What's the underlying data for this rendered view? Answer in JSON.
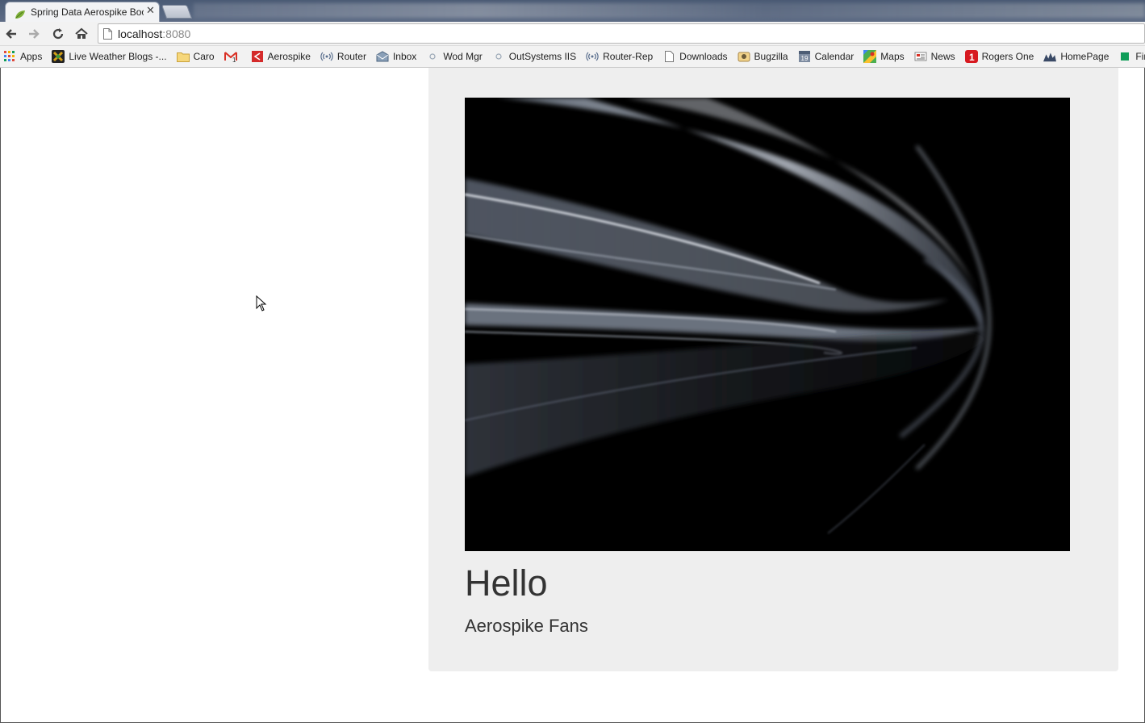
{
  "browser": {
    "active_tab": {
      "title": "Spring Data Aerospike Boo",
      "close_glyph": "✕"
    },
    "address_bar": {
      "host": "localhost",
      "port": ":8080"
    },
    "bookmarks": [
      {
        "label": "Apps",
        "icon": "apps-grid-icon"
      },
      {
        "label": "Live Weather Blogs -...",
        "icon": "weather-icon"
      },
      {
        "label": "Caro",
        "icon": "folder-icon"
      },
      {
        "label": "",
        "icon": "gmail-icon"
      },
      {
        "label": "Aerospike",
        "icon": "aerospike-icon"
      },
      {
        "label": "Router",
        "icon": "router-icon"
      },
      {
        "label": "Inbox",
        "icon": "inbox-icon"
      },
      {
        "label": "Wod Mgr",
        "icon": "globe-icon"
      },
      {
        "label": "OutSystems IIS",
        "icon": "globe-icon"
      },
      {
        "label": "Router-Rep",
        "icon": "router-icon"
      },
      {
        "label": "Downloads",
        "icon": "page-icon"
      },
      {
        "label": "Bugzilla",
        "icon": "bugzilla-icon"
      },
      {
        "label": "Calendar",
        "icon": "calendar-icon"
      },
      {
        "label": "Maps",
        "icon": "maps-icon"
      },
      {
        "label": "News",
        "icon": "news-icon"
      },
      {
        "label": "Rogers One",
        "icon": "rogers-icon"
      },
      {
        "label": "HomePage",
        "icon": "homepage-icon"
      },
      {
        "label": "Finance",
        "icon": "finance-icon"
      }
    ]
  },
  "page": {
    "heading": "Hello",
    "subheading": "Aerospike Fans"
  }
}
